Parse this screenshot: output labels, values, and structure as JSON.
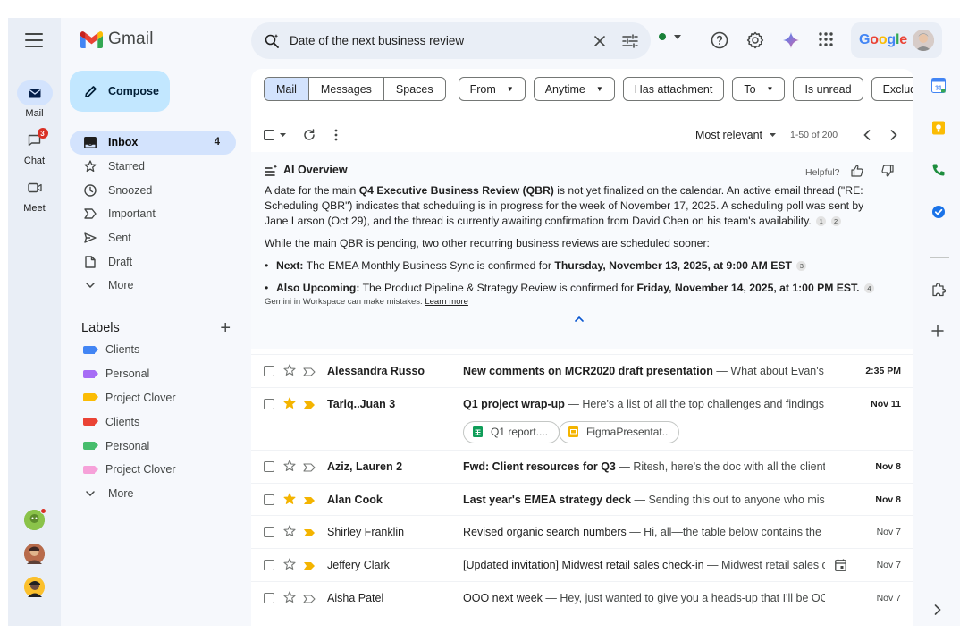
{
  "app": {
    "name": "Gmail",
    "brand_colors": {
      "accent": "#0b57d0",
      "compose_bg": "#c2e7ff",
      "active_nav": "#d3e3fd"
    }
  },
  "rail": {
    "items": [
      {
        "label": "Mail",
        "icon": "mail-icon",
        "active": true
      },
      {
        "label": "Chat",
        "icon": "chat-icon",
        "badge": "3"
      },
      {
        "label": "Meet",
        "icon": "video-icon"
      }
    ]
  },
  "search": {
    "query": "Date of the next business review"
  },
  "account": {
    "brand": "Google"
  },
  "compose": {
    "label": "Compose"
  },
  "nav": [
    {
      "label": "Inbox",
      "icon": "inbox-icon",
      "count": "4",
      "active": true
    },
    {
      "label": "Starred",
      "icon": "star-icon"
    },
    {
      "label": "Snoozed",
      "icon": "clock-icon"
    },
    {
      "label": "Important",
      "icon": "important-icon"
    },
    {
      "label": "Sent",
      "icon": "send-icon"
    },
    {
      "label": "Draft",
      "icon": "draft-icon"
    },
    {
      "label": "More",
      "icon": "chevron-down-icon"
    }
  ],
  "labels": {
    "title": "Labels",
    "items": [
      {
        "name": "Clients",
        "color": "#4285f4"
      },
      {
        "name": "Personal",
        "color": "#a66cf5"
      },
      {
        "name": "Project Clover",
        "color": "#fbbc04"
      },
      {
        "name": "Clients",
        "color": "#ea4335"
      },
      {
        "name": "Personal",
        "color": "#46bd6c"
      },
      {
        "name": "Project Clover",
        "color": "#f6a1d9"
      }
    ],
    "more": "More"
  },
  "filters": {
    "segments": [
      "Mail",
      "Messages",
      "Spaces"
    ],
    "chips": [
      {
        "label": "From",
        "dropdown": true
      },
      {
        "label": "Anytime",
        "dropdown": true
      },
      {
        "label": "Has attachment",
        "dropdown": false
      },
      {
        "label": "To",
        "dropdown": true
      },
      {
        "label": "Is unread",
        "dropdown": false
      },
      {
        "label": "Exclude cal",
        "dropdown": false
      }
    ]
  },
  "toolbar": {
    "sort": "Most relevant",
    "range": "1-50 of 200"
  },
  "ai_overview": {
    "title": "AI Overview",
    "helpful": "Helpful?",
    "p1": {
      "a": "A date for the main ",
      "b": "Q4 Executive Business Review (QBR)",
      "c": " is not yet finalized on the calendar. An active email thread (\"RE: Scheduling QBR\") indicates that scheduling is in progress for the week of November 17, 2025. A scheduling poll was sent by Jane Larson (Oct 29), and the thread is currently awaiting confirmation from David Chen on his team's availability.",
      "cites": [
        "1",
        "2"
      ]
    },
    "p2": "While the main QBR is pending, two other recurring business reviews are scheduled sooner:",
    "bullets": [
      {
        "lead": "Next:",
        "text": " The EMEA Monthly Business Sync is confirmed for ",
        "strong": "Thursday, November 13, 2025, at 9:00 AM EST",
        "cite": "3"
      },
      {
        "lead": "Also Upcoming:",
        "text": " The Product Pipeline & Strategy Review is confirmed for ",
        "strong": "Friday, November 14, 2025, at 1:00 PM EST.",
        "cite": "4"
      }
    ],
    "footer": "Gemini in Workspace can make mistakes.",
    "learn_more": "Learn more"
  },
  "emails": [
    {
      "sender": "Alessandra Russo",
      "subject": "New comments on MCR2020 draft presentation",
      "snippet": " — What about Evan's t...",
      "date": "2:35 PM",
      "unread": true,
      "starred": false,
      "important": false
    },
    {
      "sender": "Tariq..Juan 3",
      "subject": "Q1 project wrap-up",
      "snippet": " — Here's a list of all the top challenges and findings....",
      "date": "Nov 11",
      "unread": true,
      "starred": true,
      "important": true,
      "attachments": [
        {
          "name": "Q1 report....",
          "type": "sheets"
        },
        {
          "name": "FigmaPresentat..",
          "type": "slides"
        }
      ]
    },
    {
      "sender": "Aziz, Lauren 2",
      "subject": "Fwd: Client resources for Q3",
      "snippet": " — Ritesh, here's the doc with all the client r...",
      "date": "Nov 8",
      "unread": true,
      "starred": false,
      "important": false
    },
    {
      "sender": "Alan Cook",
      "subject": "Last year's EMEA strategy deck",
      "snippet": " —  Sending this out to anyone who miss...",
      "date": "Nov 8",
      "unread": true,
      "starred": true,
      "important": true
    },
    {
      "sender": "Shirley Franklin",
      "subject": "Revised organic search numbers",
      "snippet": " —  Hi, all—the table below contains the re...",
      "date": "Nov 7",
      "unread": false,
      "starred": false,
      "important": true
    },
    {
      "sender": "Jeffery Clark",
      "subject": "[Updated invitation] Midwest retail sales check-in",
      "snippet": " — Midwest retail sales c...",
      "date": "Nov 7",
      "unread": false,
      "starred": false,
      "important": true,
      "calendar": true
    },
    {
      "sender": "Aisha Patel",
      "subject": "OOO next week",
      "snippet": " — Hey, just wanted to give you a heads-up that I'll be OOO...",
      "date": "Nov 7",
      "unread": false,
      "starred": false,
      "important": false
    }
  ]
}
